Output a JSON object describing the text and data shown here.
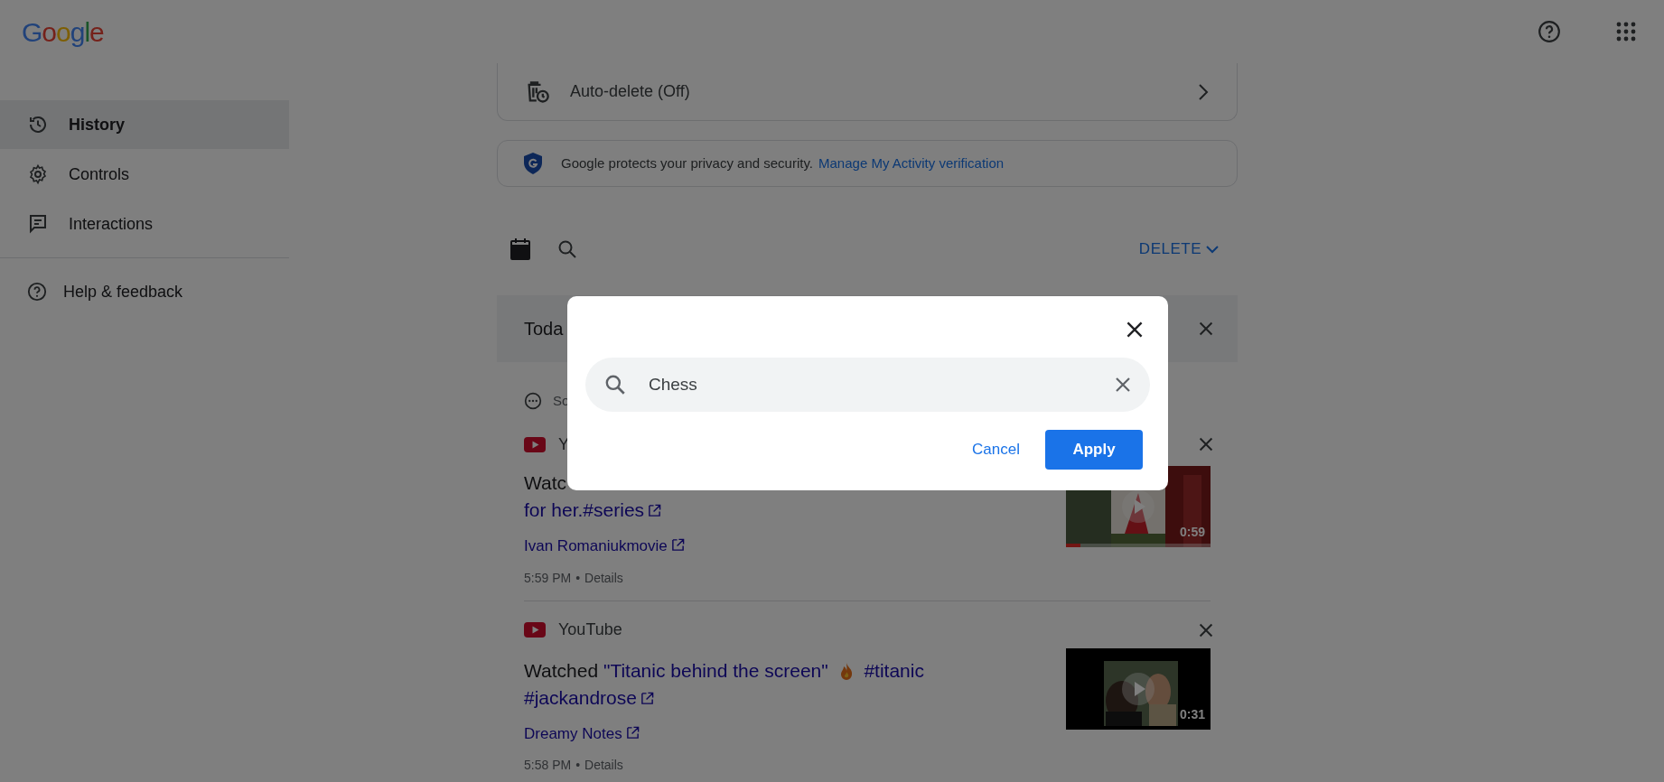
{
  "header": {
    "logo": "Google"
  },
  "sidebar": {
    "items": [
      {
        "kind": "history",
        "label": "History",
        "selected": true
      },
      {
        "kind": "controls",
        "label": "Controls",
        "selected": false
      },
      {
        "kind": "interactions",
        "label": "Interactions",
        "selected": false
      }
    ],
    "help": "Help & feedback"
  },
  "auto_delete": {
    "label": "Auto-delete (Off)"
  },
  "privacy": {
    "text": "Google protects your privacy and security.",
    "link": "Manage My Activity verification"
  },
  "toolbar": {
    "delete": "DELETE"
  },
  "day": {
    "label": "Toda"
  },
  "bundle": {
    "label": "So"
  },
  "items": [
    {
      "source": "Y",
      "prefix": "Watc",
      "break_after_prefix": true,
      "title": "for her.#series",
      "channel": "Ivan Romaniukmovie",
      "time": "5:59 PM",
      "separator": "•",
      "details": "Details",
      "duration": "0:59",
      "level": 0.1
    },
    {
      "source": "YouTube",
      "prefix": "Watched",
      "title": "\"Titanic behind the screen\"",
      "flame": true,
      "tags": "#titanic #jackandrose",
      "channel": "Dreamy Notes",
      "time": "5:58 PM",
      "separator": "•",
      "details": "Details",
      "duration": "0:31"
    }
  ],
  "dialog": {
    "search_value": "Chess",
    "cancel": "Cancel",
    "apply": "Apply"
  }
}
